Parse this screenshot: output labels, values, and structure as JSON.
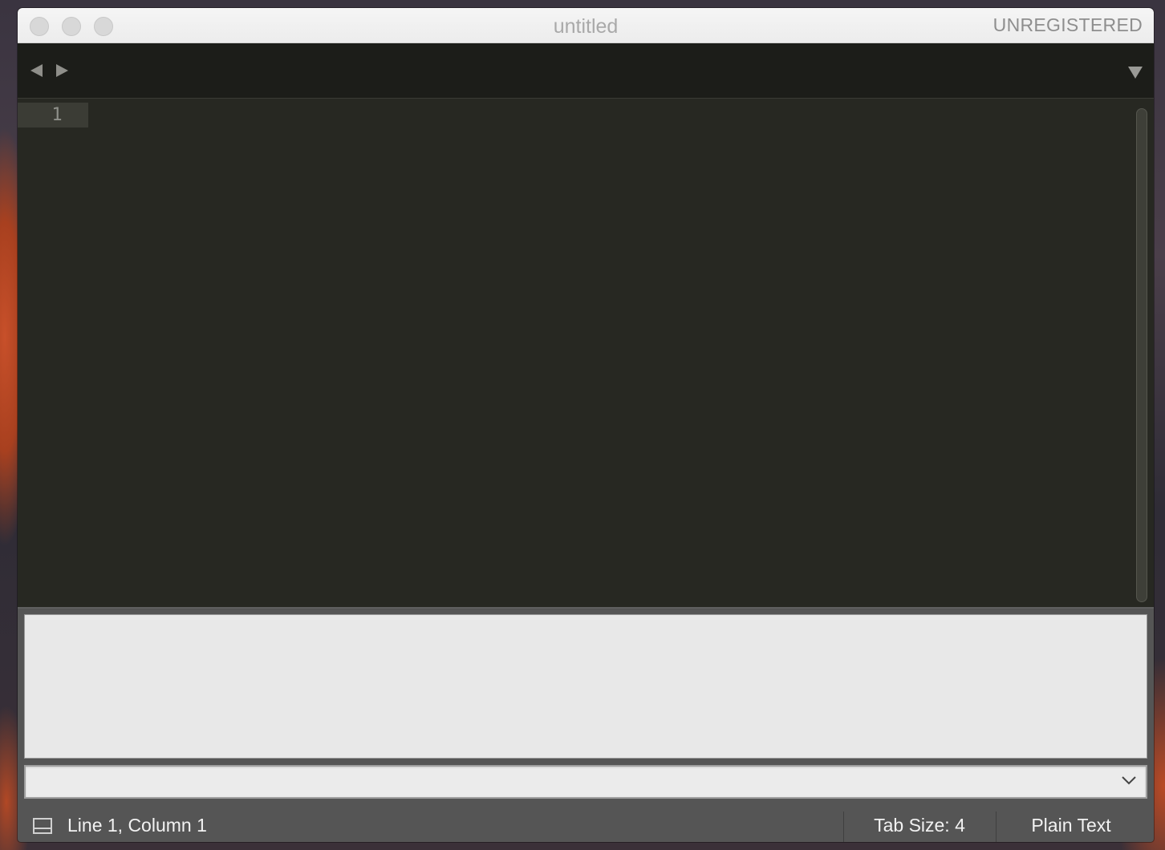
{
  "window": {
    "title": "untitled",
    "registration_status": "UNREGISTERED"
  },
  "tabbar": {
    "nav_back_icon": "triangle-left-icon",
    "nav_forward_icon": "triangle-right-icon",
    "tab_menu_icon": "triangle-down-icon"
  },
  "editor": {
    "line_numbers": [
      "1"
    ],
    "content": ""
  },
  "console": {
    "output": "",
    "input_value": "",
    "history_icon": "chevron-down-icon"
  },
  "statusbar": {
    "position": "Line 1, Column 1",
    "tab_size": "Tab Size: 4",
    "syntax": "Plain Text"
  },
  "colors": {
    "editor_bg": "#272822",
    "tabbar_bg": "#1c1d19",
    "panel_bg": "#555555",
    "console_bg": "#e8e8e8"
  }
}
